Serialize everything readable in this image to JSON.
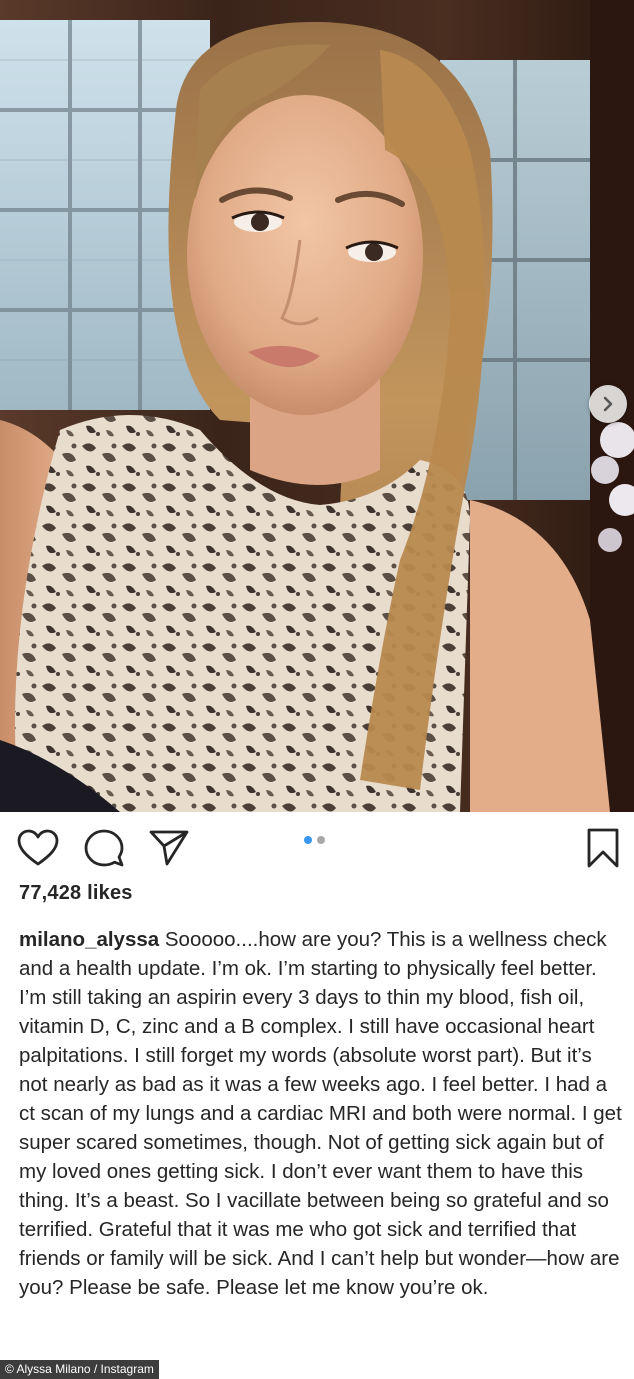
{
  "post": {
    "likes": "77,428 likes",
    "username": "milano_alyssa",
    "caption": " Sooooo....how are you? This is a wellness check and a health update. I’m ok. I’m starting to physically feel better. I’m still taking an aspirin every 3 days to thin my blood, fish oil, vitamin D, C, zinc and a B complex. I still have occasional heart palpitations. I still forget my words (absolute worst part). But it’s not nearly as bad as it was a few weeks ago. I feel better. I had a ct scan of my lungs and a cardiac MRI and both were normal. I get super scared sometimes, though. Not of getting sick again but of my loved ones getting sick. I don’t ever want them to have this thing. It’s a beast. So I vacillate between being so grateful and so terrified. Grateful that it was me who got sick and terrified that friends or family will be sick. And I can’t help but wonder—how are you? Please be safe. Please let me know you’re ok.",
    "carousel": {
      "count": 2,
      "active_index": 0
    }
  },
  "icons": {
    "like": "heart-icon",
    "comment": "comment-bubble-icon",
    "share": "paper-plane-icon",
    "save": "bookmark-icon",
    "next": "chevron-right-icon"
  },
  "credit": "© Alyssa Milano / Instagram",
  "colors": {
    "text": "#262626",
    "dot_active": "#3897f0",
    "dot_inactive": "#a8a8a8",
    "credit_bg": "#3d3d3d"
  }
}
